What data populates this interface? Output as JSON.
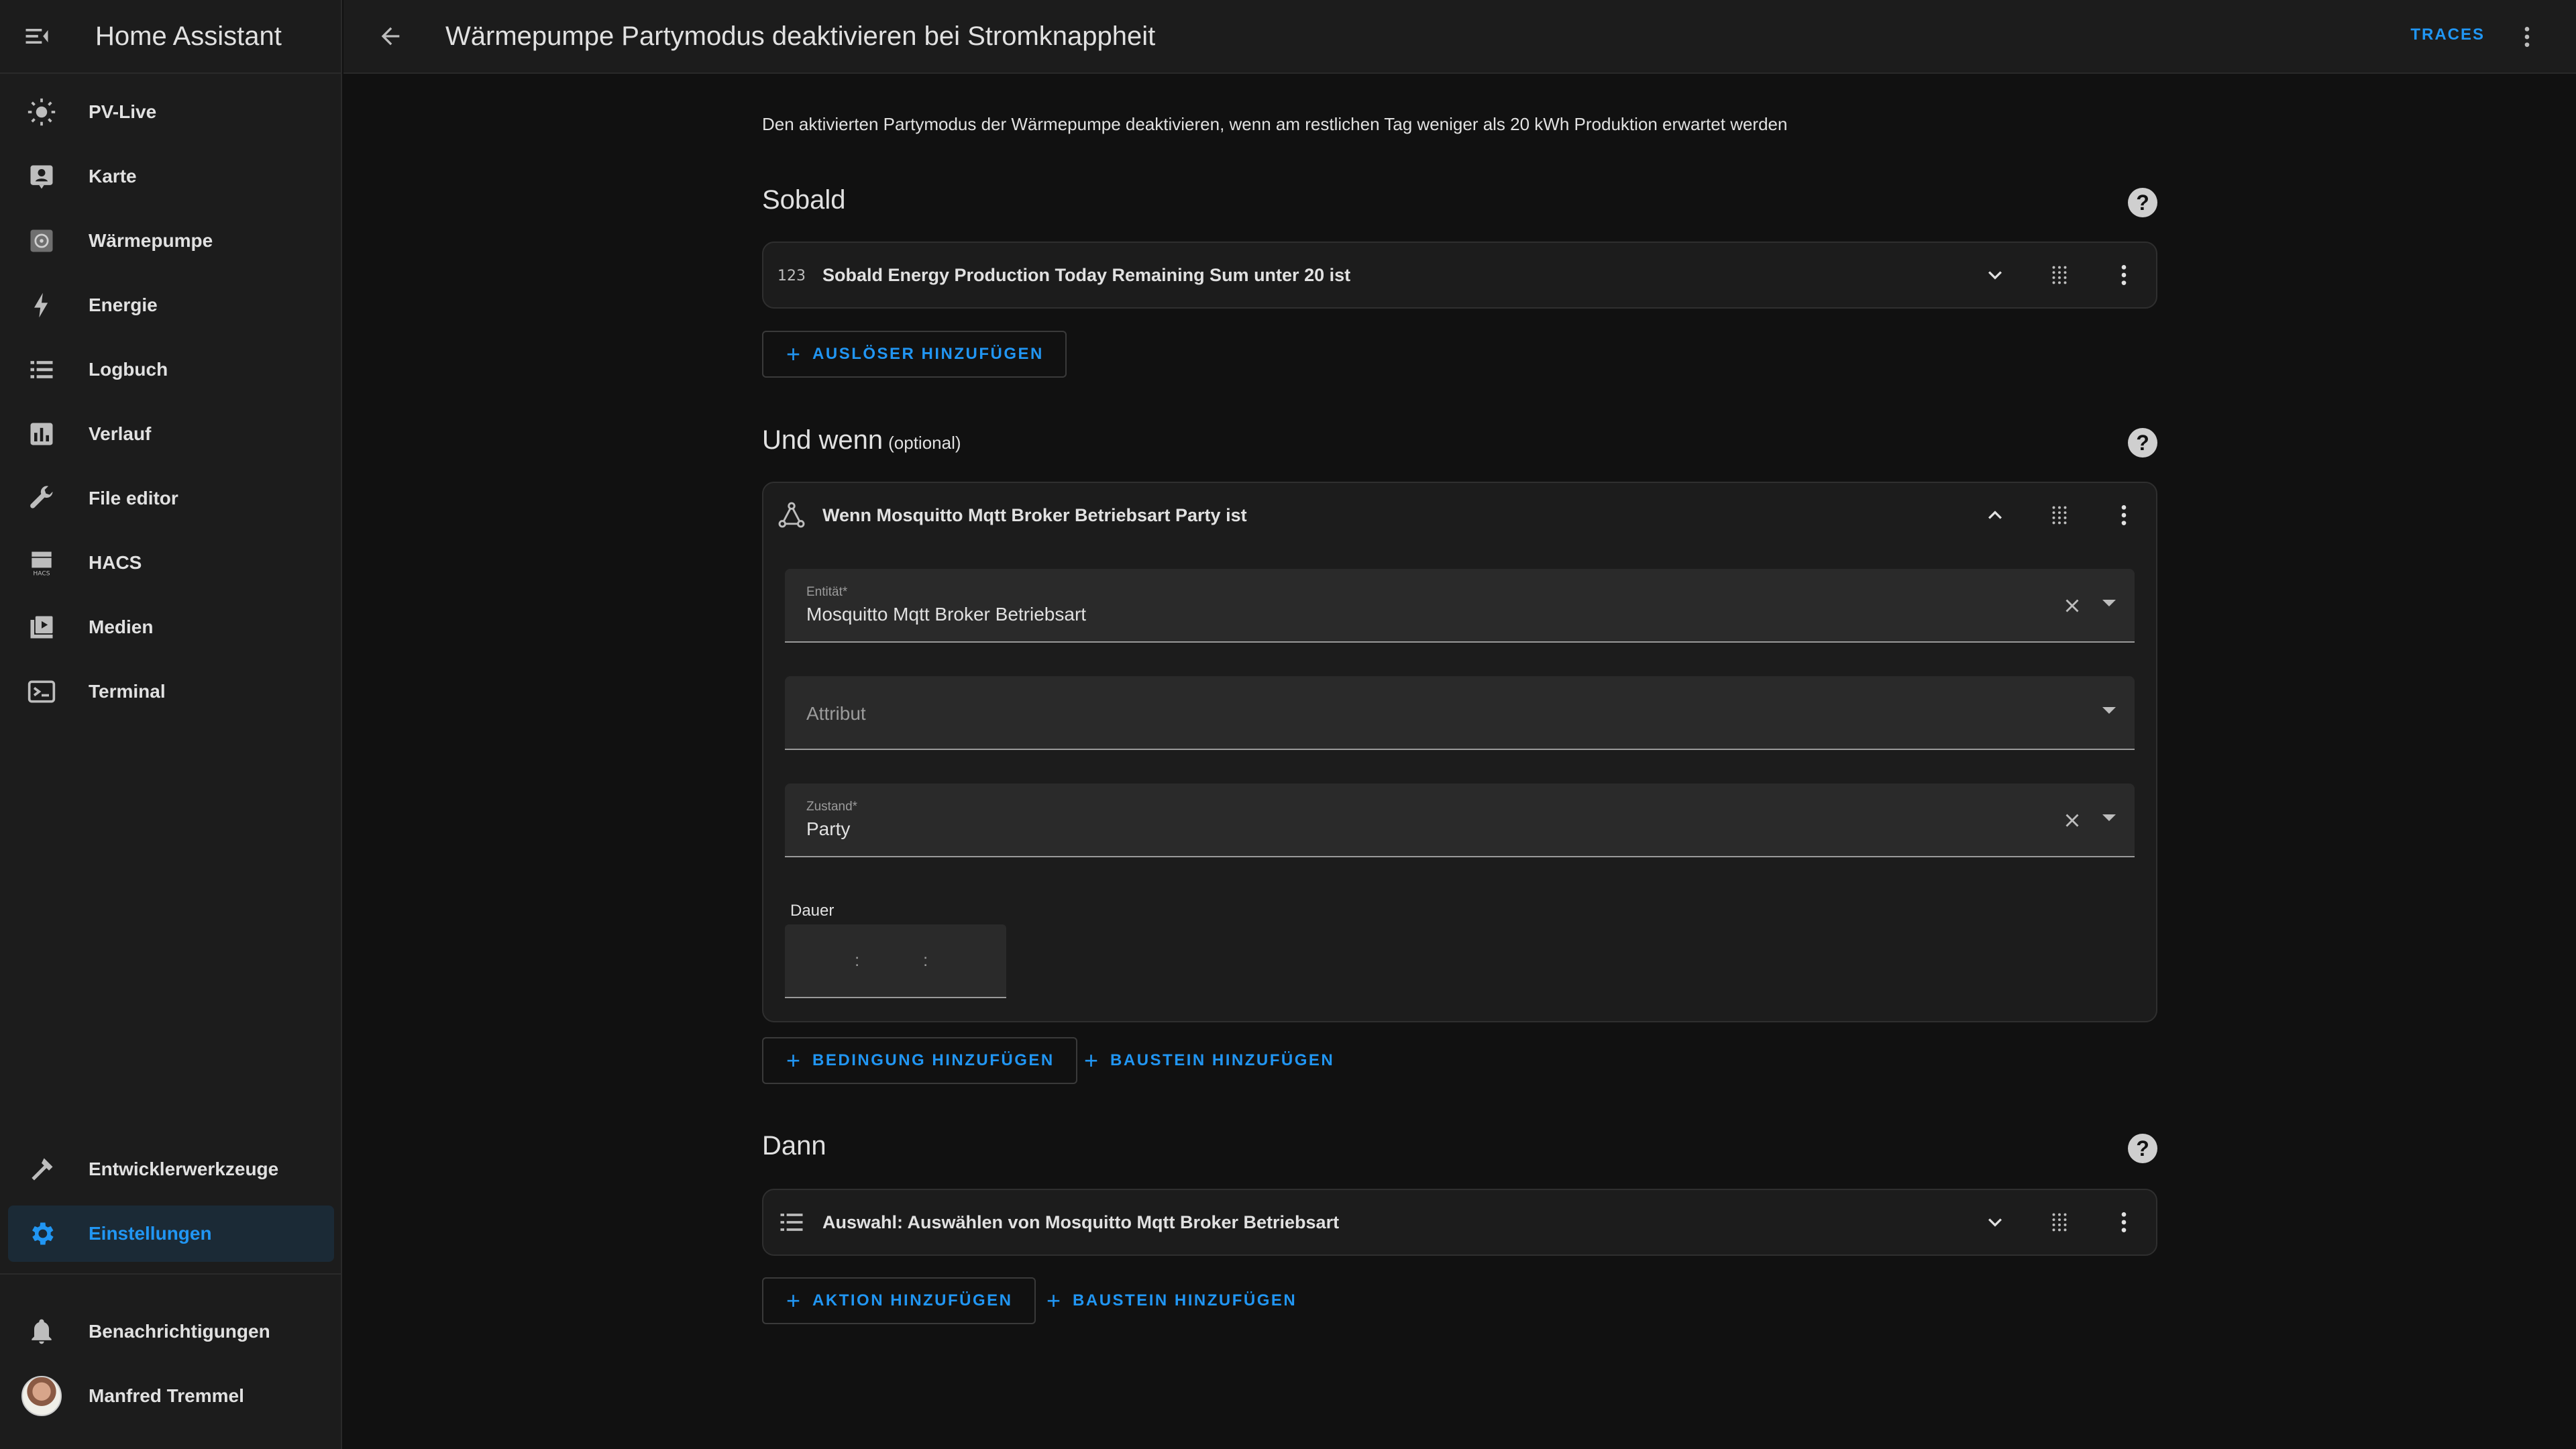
{
  "app": {
    "title": "Home Assistant"
  },
  "sidebar": {
    "items": [
      {
        "label": "PV-Live",
        "icon": "sun-icon"
      },
      {
        "label": "Karte",
        "icon": "map-person-icon"
      },
      {
        "label": "Wärmepumpe",
        "icon": "heat-pump-icon"
      },
      {
        "label": "Energie",
        "icon": "lightning-icon"
      },
      {
        "label": "Logbuch",
        "icon": "list-icon"
      },
      {
        "label": "Verlauf",
        "icon": "chart-icon"
      },
      {
        "label": "File editor",
        "icon": "wrench-icon"
      },
      {
        "label": "HACS",
        "icon": "hacs-icon"
      },
      {
        "label": "Medien",
        "icon": "media-icon"
      },
      {
        "label": "Terminal",
        "icon": "terminal-icon"
      }
    ],
    "bottom": [
      {
        "label": "Entwicklerwerkzeuge",
        "icon": "hammer-icon"
      },
      {
        "label": "Einstellungen",
        "icon": "gear-icon",
        "active": true
      }
    ],
    "notifications": "Benachrichtigungen",
    "user": "Manfred Tremmel"
  },
  "topbar": {
    "title": "Wärmepumpe Partymodus deaktivieren bei Stromknappheit",
    "traces": "TRACES"
  },
  "description": "Den aktivierten Partymodus der Wärmepumpe deaktivieren, wenn am restlichen Tag weniger als 20 kWh Produktion erwartet werden",
  "sections": {
    "triggers": {
      "title": "Sobald",
      "card_title": "Sobald Energy Production Today Remaining Sum unter 20 ist",
      "add_button": "AUSLÖSER HINZUFÜGEN"
    },
    "conditions": {
      "title": "Und wenn",
      "optional": "(optional)",
      "card_title": "Wenn Mosquitto Mqtt Broker Betriebsart Party ist",
      "entity_label": "Entität*",
      "entity_value": "Mosquitto Mqtt Broker Betriebsart",
      "attribute_placeholder": "Attribut",
      "state_label": "Zustand*",
      "state_value": "Party",
      "duration_label": "Dauer",
      "time_separator": ":",
      "add_condition": "BEDINGUNG HINZUFÜGEN",
      "add_block": "BAUSTEIN HINZUFÜGEN"
    },
    "actions": {
      "title": "Dann",
      "card_title": "Auswahl: Auswählen von Mosquitto Mqtt Broker Betriebsart",
      "add_action": "AKTION HINZUFÜGEN",
      "add_block": "BAUSTEIN HINZUFÜGEN"
    }
  },
  "colors": {
    "accent": "#2196f3",
    "background": "#111111",
    "card": "#1c1c1c"
  }
}
